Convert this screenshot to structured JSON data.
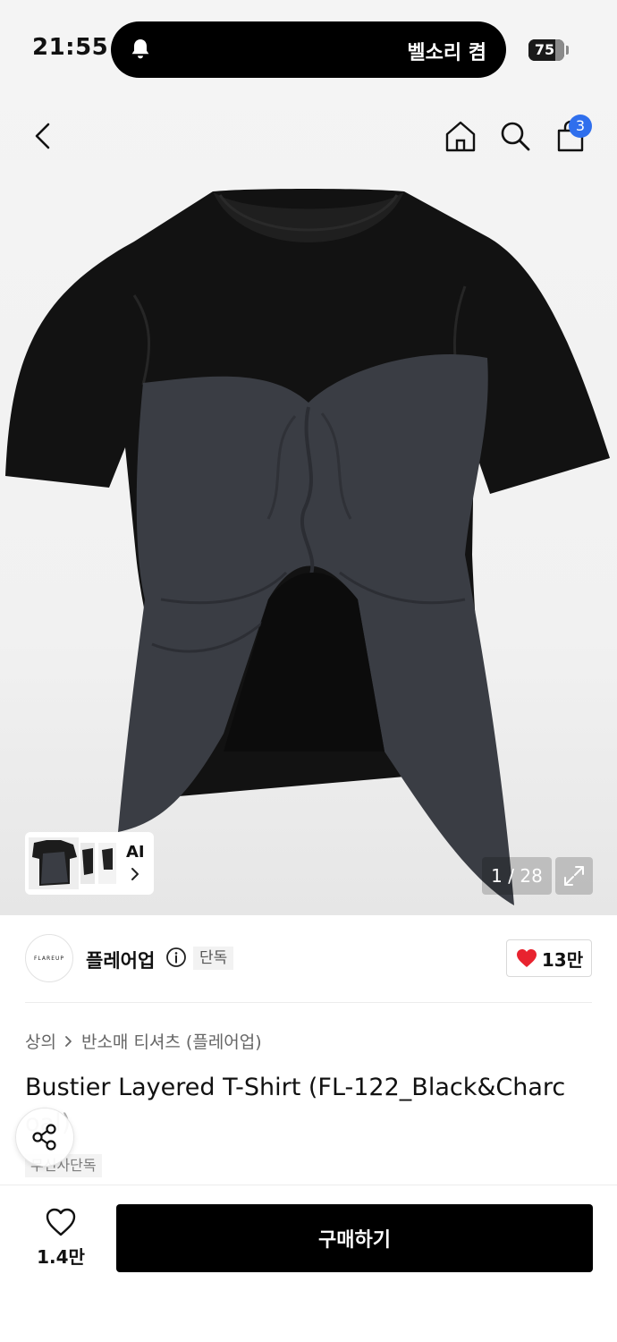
{
  "status_bar": {
    "time": "21:55",
    "ringer_text": "벨소리 켬",
    "battery_level": "75"
  },
  "nav": {
    "cart_count": "3"
  },
  "gallery": {
    "ai_label": "AI",
    "counter": "1 / 28"
  },
  "brand": {
    "logo_text": "FLAREUP",
    "name": "플레어업",
    "exclusive_badge": "단독",
    "like_count": "13만"
  },
  "breadcrumb": {
    "category": "상의",
    "subcategory": "반소매 티셔츠 (플레어업)"
  },
  "product": {
    "title_line1": "Bustier Layered T-Shirt (FL-122_Black&Charc",
    "title_line2": "oal)",
    "tag": "무신사단독"
  },
  "bottom_bar": {
    "wish_count": "1.4만",
    "buy_label": "구매하기"
  },
  "colors": {
    "accent_blue": "#2f6fed",
    "heart_red": "#e8232f",
    "buy_button": "#000000"
  }
}
